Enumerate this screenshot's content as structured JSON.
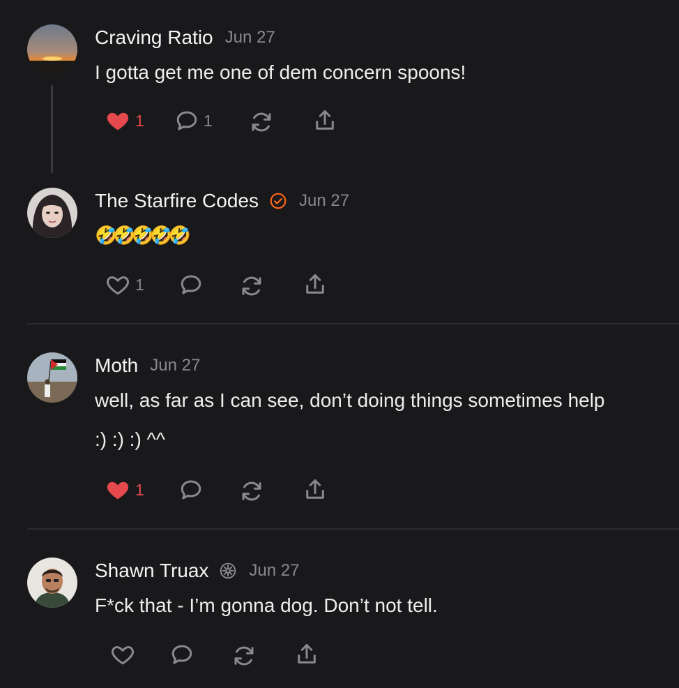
{
  "colors": {
    "background": "#19191b",
    "like_active": "#e5484d",
    "muted_text": "#8a8a8e",
    "verified_badge": "#ff6719"
  },
  "comments": [
    {
      "author": "Craving Ratio",
      "date": "Jun 27",
      "lines": [
        "I gotta get me one of dem concern spoons!"
      ],
      "likes": "1",
      "liked": true,
      "replies": "1",
      "avatar_icon": "sunset-avatar",
      "badge": null
    },
    {
      "author": "The Starfire Codes",
      "date": "Jun 27",
      "lines": [
        "🤣🤣🤣🤣🤣"
      ],
      "likes": "1",
      "liked": false,
      "replies": "",
      "avatar_icon": "woman-avatar",
      "badge": "verified-check-icon"
    },
    {
      "author": "Moth",
      "date": "Jun 27",
      "lines": [
        "well, as far as I can see, don’t doing things sometimes help",
        ":) :) :) ^^"
      ],
      "likes": "1",
      "liked": true,
      "replies": "",
      "avatar_icon": "flag-avatar",
      "badge": null
    },
    {
      "author": "Shawn Truax",
      "date": "Jun 27",
      "lines": [
        "F*ck that - I’m gonna dog. Don’t not tell."
      ],
      "likes": "",
      "liked": false,
      "replies": "",
      "avatar_icon": "man-avatar",
      "badge": "founding-badge-icon"
    }
  ]
}
